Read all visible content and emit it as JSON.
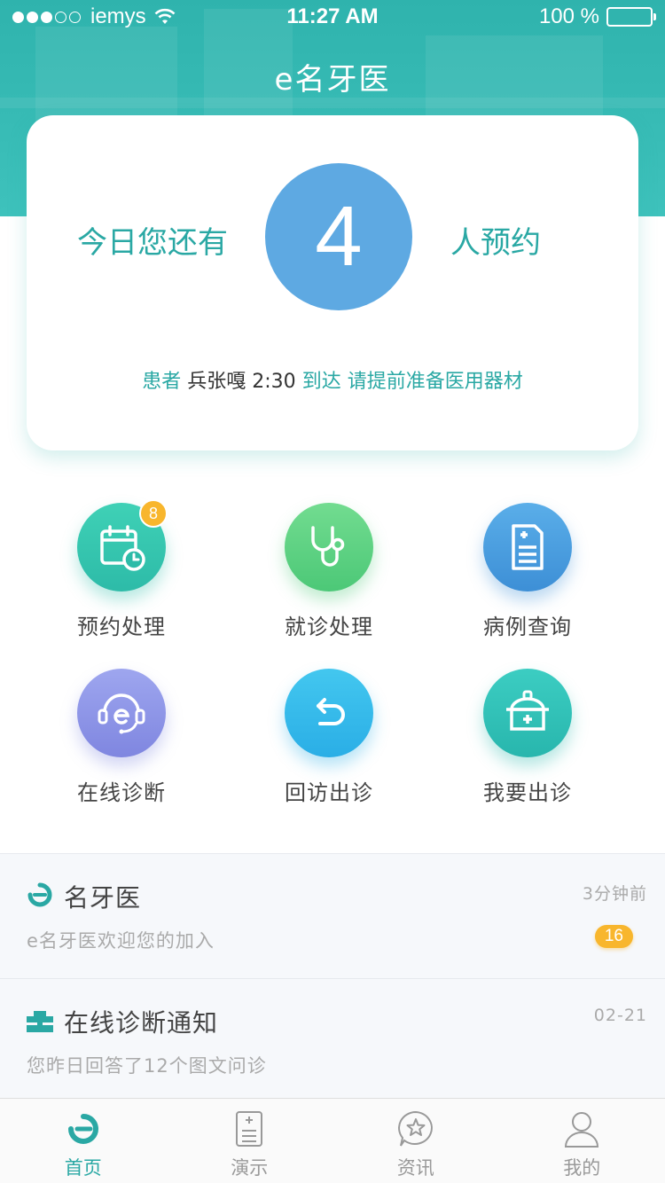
{
  "status_bar": {
    "carrier": "iemys",
    "time": "11:27 AM",
    "battery": "100 %"
  },
  "header": {
    "title": "e名牙医"
  },
  "summary": {
    "prefix": "今日您还有",
    "count": "4",
    "suffix": "人预约",
    "notice": {
      "patient_label": "患者",
      "patient_info": "兵张嘎 2:30",
      "arrive": "到达",
      "reminder": "请提前准备医用器材"
    }
  },
  "features": [
    {
      "label": "预约处理",
      "icon": "calendar-clock-icon",
      "badge": "8"
    },
    {
      "label": "就诊处理",
      "icon": "stethoscope-icon"
    },
    {
      "label": "病例查询",
      "icon": "medical-record-icon"
    },
    {
      "label": "在线诊断",
      "icon": "headset-e-icon"
    },
    {
      "label": "回访出诊",
      "icon": "return-arrow-icon"
    },
    {
      "label": "我要出诊",
      "icon": "medical-kit-icon"
    }
  ],
  "messages": [
    {
      "title": "名牙医",
      "time": "3分钟前",
      "subtitle": "e名牙医欢迎您的加入",
      "badge": "16",
      "icon": "app-logo-icon"
    },
    {
      "title": "在线诊断通知",
      "time": "02-21",
      "subtitle": "您昨日回答了12个图文问诊",
      "icon": "clinic-icon"
    }
  ],
  "tabs": [
    {
      "label": "首页",
      "icon": "home-logo-icon",
      "active": true
    },
    {
      "label": "演示",
      "icon": "document-icon"
    },
    {
      "label": "资讯",
      "icon": "star-chat-icon"
    },
    {
      "label": "我的",
      "icon": "user-icon"
    }
  ],
  "colors": {
    "primary": "#2aa8a4",
    "header_bg": "#37bbb5",
    "count_circle": "#5ea9e2",
    "badge": "#f8b62d"
  }
}
